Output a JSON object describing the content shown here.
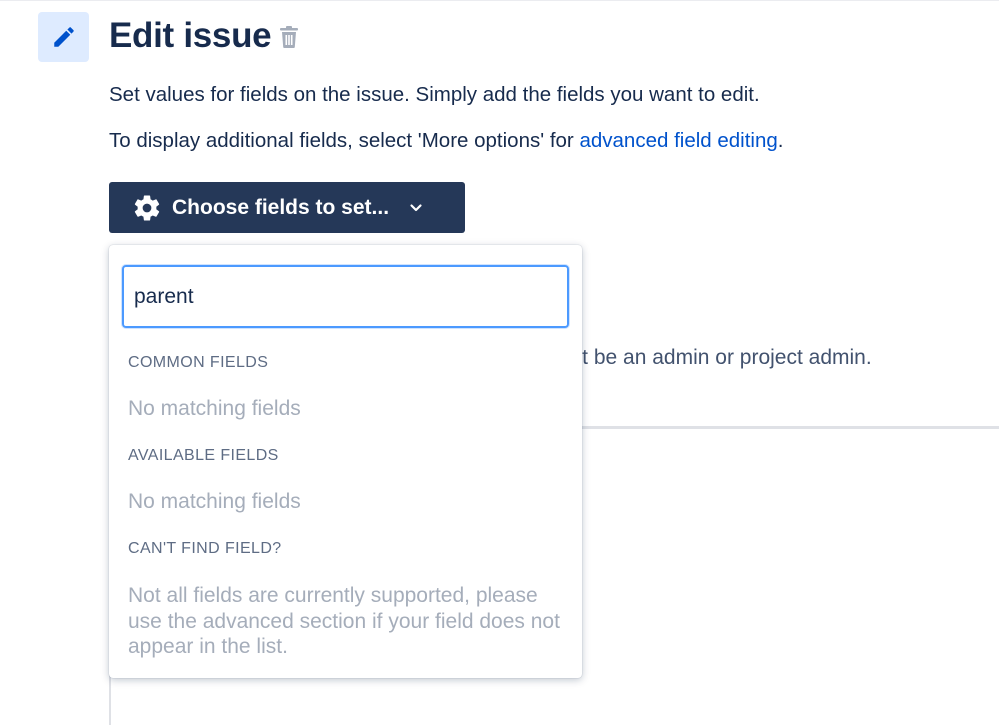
{
  "header": {
    "title": "Edit issue",
    "edit_icon": "pencil-icon",
    "delete_icon": "trash-icon"
  },
  "description": {
    "line1": "Set values for fields on the issue. Simply add the fields you want to edit.",
    "line2_prefix": "To display additional fields, select 'More options' for ",
    "line2_link": "advanced field editing",
    "line2_suffix": "."
  },
  "choose_button": {
    "label": "Choose fields to set...",
    "icon": "gear-icon",
    "caret_icon": "chevron-down-icon"
  },
  "dropdown": {
    "search_value": "parent",
    "sections": [
      {
        "heading": "COMMON FIELDS",
        "empty_text": "No matching fields"
      },
      {
        "heading": "AVAILABLE FIELDS",
        "empty_text": "No matching fields"
      },
      {
        "heading": "CAN'T FIND FIELD?",
        "help_text": "Not all fields are currently supported, please use the advanced section if your field does not appear in the list."
      }
    ]
  },
  "background": {
    "partial_note": "ust be an admin or project admin."
  },
  "colors": {
    "primary_text": "#172b4d",
    "link": "#0052cc",
    "button_bg": "#253858",
    "focus_border": "#4c9aff",
    "muted_text": "#a5adba",
    "icon_box_bg": "#deebff"
  }
}
